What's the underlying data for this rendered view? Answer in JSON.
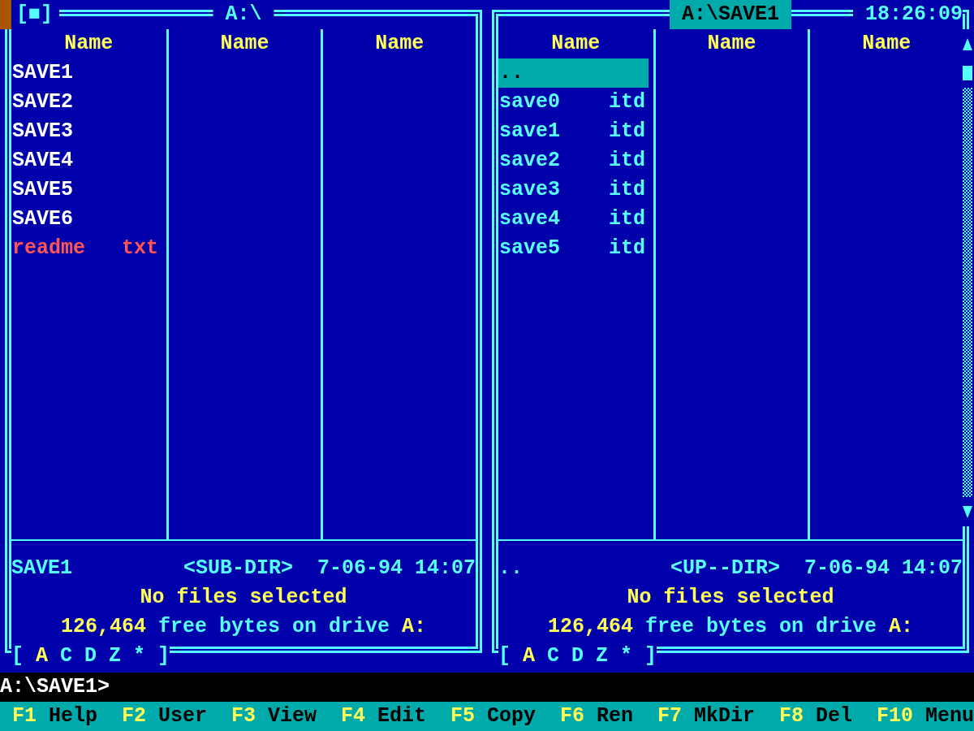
{
  "panels": [
    {
      "active": false,
      "window_button": "[■]",
      "title": "A:\\",
      "scrollbar": false,
      "columns": [
        {
          "header": "Name",
          "items": [
            {
              "name": "SAVE1",
              "kind": "directory",
              "selected": false
            },
            {
              "name": "SAVE2",
              "kind": "directory",
              "selected": false
            },
            {
              "name": "SAVE3",
              "kind": "directory",
              "selected": false
            },
            {
              "name": "SAVE4",
              "kind": "directory",
              "selected": false
            },
            {
              "name": "SAVE5",
              "kind": "directory",
              "selected": false
            },
            {
              "name": "SAVE6",
              "kind": "directory",
              "selected": false
            },
            {
              "name": "readme",
              "ext": "txt",
              "kind": "document",
              "selected": false
            }
          ]
        },
        {
          "header": "Name"
        },
        {
          "header": "Name"
        }
      ],
      "info": {
        "name": "SAVE1",
        "type": "<SUB-DIR>",
        "date": "7-06-94",
        "time": "14:07"
      },
      "selection_note": "No files selected",
      "free": {
        "bytes": "126,464",
        "text": "free bytes on drive",
        "drive": "A:"
      },
      "drive_bar": {
        "open": "[",
        "drives": [
          {
            "label": "A",
            "selected": true
          },
          {
            "label": "C",
            "selected": false
          },
          {
            "label": "D",
            "selected": false
          },
          {
            "label": "Z",
            "selected": false
          },
          {
            "label": "*",
            "selected": false
          }
        ],
        "close": "]"
      }
    },
    {
      "active": true,
      "title": "A:\\SAVE1",
      "clock": "18:26:09",
      "scrollbar": true,
      "columns": [
        {
          "header": "Name",
          "items": [
            {
              "name": "..",
              "kind": "file",
              "selected": true
            },
            {
              "name": "save0",
              "ext": "itd",
              "kind": "file",
              "selected": false
            },
            {
              "name": "save1",
              "ext": "itd",
              "kind": "file",
              "selected": false
            },
            {
              "name": "save2",
              "ext": "itd",
              "kind": "file",
              "selected": false
            },
            {
              "name": "save3",
              "ext": "itd",
              "kind": "file",
              "selected": false
            },
            {
              "name": "save4",
              "ext": "itd",
              "kind": "file",
              "selected": false
            },
            {
              "name": "save5",
              "ext": "itd",
              "kind": "file",
              "selected": false
            }
          ]
        },
        {
          "header": "Name"
        },
        {
          "header": "Name"
        }
      ],
      "info": {
        "name": "..",
        "type": "<UP--DIR>",
        "date": "7-06-94",
        "time": "14:07"
      },
      "selection_note": "No files selected",
      "free": {
        "bytes": "126,464",
        "text": "free bytes on drive",
        "drive": "A:"
      },
      "drive_bar": {
        "open": "[",
        "drives": [
          {
            "label": "A",
            "selected": true
          },
          {
            "label": "C",
            "selected": false
          },
          {
            "label": "D",
            "selected": false
          },
          {
            "label": "Z",
            "selected": false
          },
          {
            "label": "*",
            "selected": false
          }
        ],
        "close": "]"
      }
    }
  ],
  "command_line": {
    "prompt": "A:\\SAVE1>"
  },
  "function_keys": [
    {
      "key": "F1",
      "label": "Help"
    },
    {
      "key": "F2",
      "label": "User"
    },
    {
      "key": "F3",
      "label": "View"
    },
    {
      "key": "F4",
      "label": "Edit"
    },
    {
      "key": "F5",
      "label": "Copy"
    },
    {
      "key": "F6",
      "label": "Ren"
    },
    {
      "key": "F7",
      "label": "MkDir"
    },
    {
      "key": "F8",
      "label": "Del"
    },
    {
      "key": "F10",
      "label": "Menu"
    }
  ]
}
